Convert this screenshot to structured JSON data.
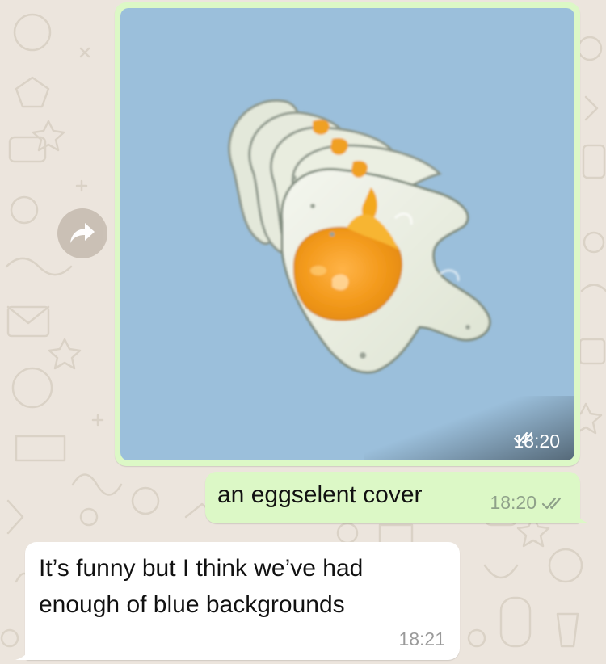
{
  "colors": {
    "wallpaper": "#ece5dd",
    "outgoing_bubble": "#dcf8c6",
    "incoming_bubble": "#ffffff",
    "photo_background": "#9bbfdb",
    "read_ticks": "#8fa18a"
  },
  "messages": {
    "image": {
      "time": "18:20",
      "status_icon": "double-check-icon"
    },
    "forward": {
      "icon": "share-arrow-icon"
    },
    "outgoing_text": {
      "text": "an eggselent cover",
      "time": "18:20",
      "status_icon": "double-check-icon"
    },
    "incoming_text": {
      "text": "It’s funny but I think we’ve had enough of blue backgrounds",
      "time": "18:21"
    }
  }
}
